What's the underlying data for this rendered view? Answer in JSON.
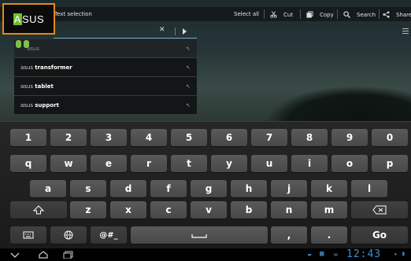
{
  "action_bar": {
    "title": "Text selection",
    "actions": [
      {
        "label": "Select all",
        "icon": "none"
      },
      {
        "label": "Cut",
        "icon": "scissors-icon"
      },
      {
        "label": "Copy",
        "icon": "copy-icon"
      },
      {
        "label": "Search",
        "icon": "search-icon"
      },
      {
        "label": "Share",
        "icon": "share-icon"
      }
    ]
  },
  "logo": {
    "text": "ASUS",
    "highlight": "A",
    "rest": "SUS",
    "accent": "#e58a1a",
    "highlight_color": "#6ebf2a"
  },
  "search": {
    "value": "",
    "clear_icon": "close-icon",
    "go_icon": "play-icon"
  },
  "suggestions": [
    {
      "prefix": "asus",
      "bold": ""
    },
    {
      "prefix": "asus ",
      "bold": "transformer"
    },
    {
      "prefix": "asus ",
      "bold": "tablet"
    },
    {
      "prefix": "asus ",
      "bold": "support"
    }
  ],
  "keyboard": {
    "row1": [
      "1",
      "2",
      "3",
      "4",
      "5",
      "6",
      "7",
      "8",
      "9",
      "0"
    ],
    "row2": [
      "q",
      "w",
      "e",
      "r",
      "t",
      "y",
      "u",
      "i",
      "o",
      "p"
    ],
    "row3": [
      "a",
      "s",
      "d",
      "f",
      "g",
      "h",
      "j",
      "k",
      "l"
    ],
    "row4": [
      "z",
      "x",
      "c",
      "v",
      "b",
      "n",
      "m"
    ],
    "symbols_label": "@#_",
    "comma": ",",
    "period": ".",
    "go_label": "Go"
  },
  "status_bar": {
    "time": "12:43"
  }
}
